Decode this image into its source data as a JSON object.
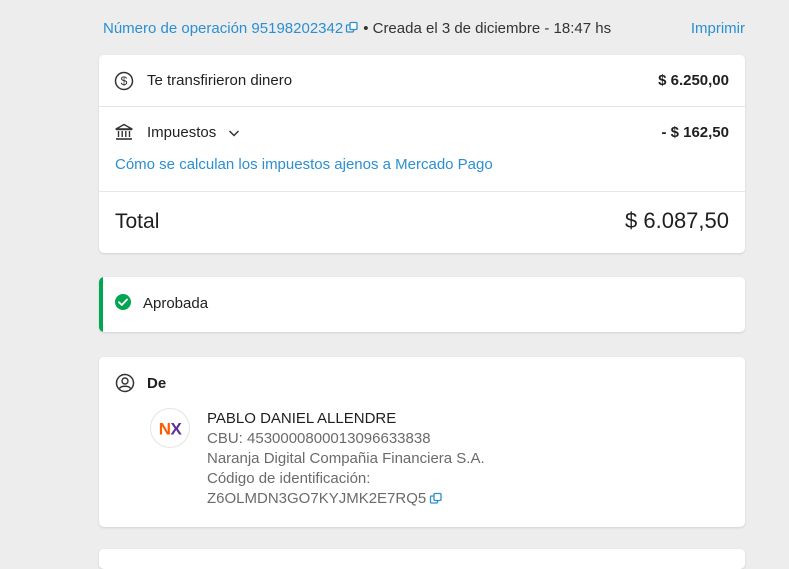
{
  "header": {
    "operation_label": "Número de operación 95198202342",
    "meta": "• Creada el 3 de diciembre - 18:47 hs",
    "print_label": "Imprimir"
  },
  "summary": {
    "transfer_label": "Te transfirieron dinero",
    "transfer_amount": "$ 6.250,00",
    "taxes_label": "Impuestos",
    "taxes_amount": "- $ 162,50",
    "taxes_link": "Cómo se calculan los impuestos ajenos a Mercado Pago",
    "total_label": "Total",
    "total_amount": "$ 6.087,50"
  },
  "status": {
    "label": "Aprobada",
    "color": "#00a650"
  },
  "from": {
    "label": "De",
    "name": "PABLO DANIEL ALLENDRE",
    "cbu": "CBU: 4530000800013096633838",
    "bank": "Naranja Digital Compañia Financiera S.A.",
    "code_label": "Código de identificación:",
    "code_value": "Z6OLMDN3GO7KYJMK2E7RQ5",
    "logo_text": "NX"
  },
  "colors": {
    "link": "#2b8fd0",
    "success": "#00a650",
    "logo_n": "#ff5a00",
    "logo_x": "#5a2ca0"
  },
  "icons": {
    "copy": "copy-icon",
    "dollar": "dollar-circle-icon",
    "bank": "bank-icon",
    "chevron": "chevron-down-icon",
    "check": "check-circle-icon",
    "user": "user-circle-icon"
  }
}
